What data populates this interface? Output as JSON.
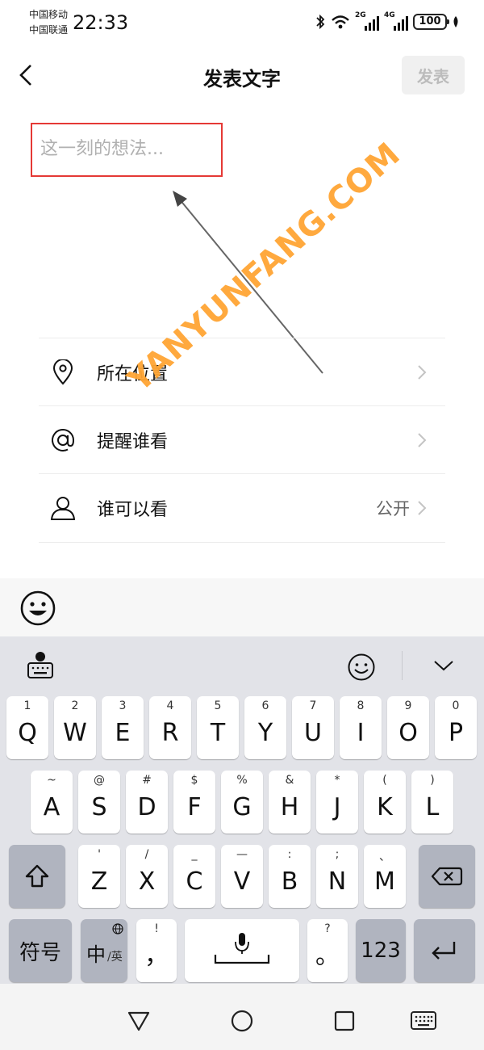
{
  "status_bar": {
    "carrier1": "中国移动",
    "carrier2": "中国联通",
    "time": "22:33",
    "signal1": "2G",
    "signal2": "4G",
    "battery": "100"
  },
  "header": {
    "title": "发表文字",
    "publish": "发表"
  },
  "composer": {
    "placeholder": "这一刻的想法..."
  },
  "watermark": "YANYUNFANG.COM",
  "options": [
    {
      "label": "所在位置",
      "value": ""
    },
    {
      "label": "提醒谁看",
      "value": ""
    },
    {
      "label": "谁可以看",
      "value": "公开"
    }
  ],
  "keyboard": {
    "row1": [
      {
        "num": "1",
        "letter": "Q"
      },
      {
        "num": "2",
        "letter": "W"
      },
      {
        "num": "3",
        "letter": "E"
      },
      {
        "num": "4",
        "letter": "R"
      },
      {
        "num": "5",
        "letter": "T"
      },
      {
        "num": "6",
        "letter": "Y"
      },
      {
        "num": "7",
        "letter": "U"
      },
      {
        "num": "8",
        "letter": "I"
      },
      {
        "num": "9",
        "letter": "O"
      },
      {
        "num": "0",
        "letter": "P"
      }
    ],
    "row2": [
      {
        "num": "~",
        "letter": "A"
      },
      {
        "num": "@",
        "letter": "S"
      },
      {
        "num": "#",
        "letter": "D"
      },
      {
        "num": "$",
        "letter": "F"
      },
      {
        "num": "%",
        "letter": "G"
      },
      {
        "num": "&",
        "letter": "H"
      },
      {
        "num": "*",
        "letter": "J"
      },
      {
        "num": "(",
        "letter": "K"
      },
      {
        "num": ")",
        "letter": "L"
      }
    ],
    "row3": [
      {
        "num": "'",
        "letter": "Z"
      },
      {
        "num": "/",
        "letter": "X"
      },
      {
        "num": "_",
        "letter": "C"
      },
      {
        "num": "—",
        "letter": "V"
      },
      {
        "num": ":",
        "letter": "B"
      },
      {
        "num": ";",
        "letter": "N"
      },
      {
        "num": "、",
        "letter": "M"
      }
    ],
    "symbols_label": "符号",
    "lang_main": "中",
    "lang_sub": "/英",
    "comma_top": "!",
    "comma": "，",
    "period_top": "?",
    "period": "。",
    "num_label": "123"
  }
}
